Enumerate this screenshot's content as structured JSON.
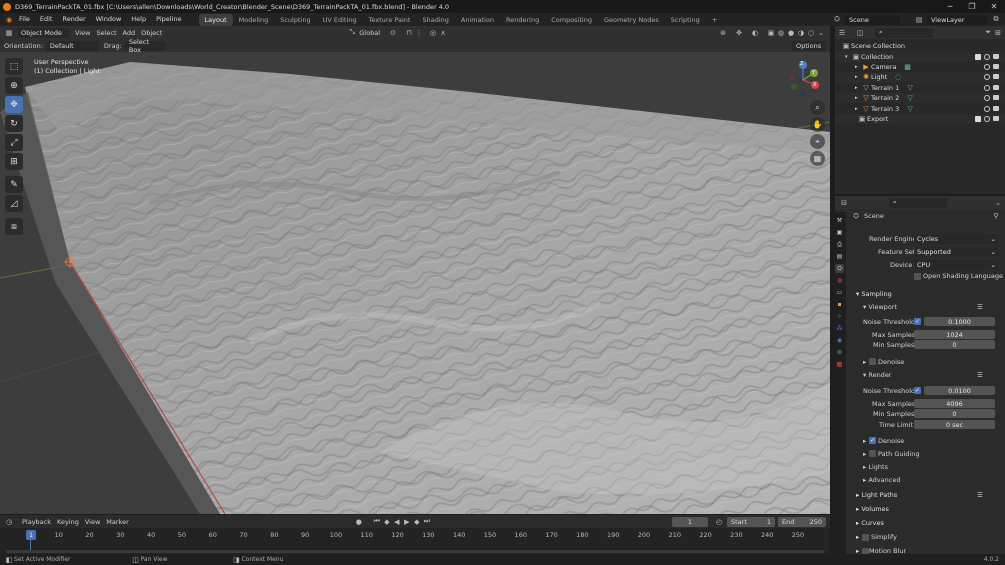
{
  "window": {
    "title": "D369_TerrainPackTA_01.fbx [C:\\Users\\allen\\Downloads\\World_Creator\\Blender_Scene\\D369_TerrainPackTA_01.fbx.blend] - Blender 4.0",
    "minimize": "─",
    "maximize": "❐",
    "close": "✕"
  },
  "menu": [
    "File",
    "Edit",
    "Render",
    "Window",
    "Help",
    "Pipeline"
  ],
  "workspaces": [
    "Layout",
    "Modeling",
    "Sculpting",
    "UV Editing",
    "Texture Paint",
    "Shading",
    "Animation",
    "Rendering",
    "Compositing",
    "Geometry Nodes",
    "Scripting"
  ],
  "active_workspace": "Layout",
  "scene_name": "Scene",
  "view_layer": "ViewLayer",
  "header": {
    "mode": "Object Mode",
    "view": "View",
    "select": "Select",
    "add": "Add",
    "object": "Object",
    "transform": "Global",
    "options": "Options"
  },
  "tool_options": {
    "orientation_label": "Orientation:",
    "orientation_value": "Default",
    "drag_label": "Drag:",
    "drag_value": "Select Box"
  },
  "viewport": {
    "perspective": "User Perspective",
    "collection_info": "(1) Collection | Light"
  },
  "gizmo": {
    "x": "X",
    "y": "Y",
    "z": "Z"
  },
  "outliner": {
    "root": "Scene Collection",
    "items": [
      {
        "name": "Collection",
        "depth": 1,
        "icon": "collection"
      },
      {
        "name": "Camera",
        "depth": 2,
        "icon": "camera"
      },
      {
        "name": "Light",
        "depth": 2,
        "icon": "light"
      },
      {
        "name": "Terrain 1",
        "depth": 2,
        "icon": "mesh"
      },
      {
        "name": "Terrain 2",
        "depth": 2,
        "icon": "mesh"
      },
      {
        "name": "Terrain 3",
        "depth": 2,
        "icon": "mesh"
      },
      {
        "name": "Export",
        "depth": 1,
        "icon": "collection"
      }
    ]
  },
  "properties": {
    "context": "Scene",
    "render_engine_label": "Render Engine",
    "render_engine": "Cycles",
    "feature_set_label": "Feature Set",
    "feature_set": "Supported",
    "device_label": "Device",
    "device": "CPU",
    "osl": "Open Shading Language",
    "sampling": "Sampling",
    "viewport": "Viewport",
    "noise_threshold_label": "Noise Threshold",
    "viewport_noise": "0.1000",
    "max_samples_label": "Max Samples",
    "viewport_max": "1024",
    "min_samples_label": "Min Samples",
    "viewport_min": "0",
    "denoise": "Denoise",
    "render": "Render",
    "render_noise": "0.0100",
    "render_max": "4096",
    "render_min": "0",
    "time_limit_label": "Time Limit",
    "time_limit": "0 sec",
    "path_guiding": "Path Guiding",
    "lights": "Lights",
    "advanced": "Advanced",
    "light_paths": "Light Paths",
    "volumes": "Volumes",
    "curves": "Curves",
    "simplify": "Simplify",
    "motion_blur": "Motion Blur"
  },
  "timeline": {
    "playback": "Playback",
    "keying": "Keying",
    "view": "View",
    "marker": "Marker",
    "current_frame": "1",
    "start_label": "Start",
    "start": "1",
    "end_label": "End",
    "end": "250",
    "ticks": [
      "1",
      "10",
      "20",
      "30",
      "40",
      "50",
      "60",
      "70",
      "80",
      "90",
      "100",
      "110",
      "120",
      "130",
      "140",
      "150",
      "160",
      "170",
      "180",
      "190",
      "200",
      "210",
      "220",
      "230",
      "240",
      "250"
    ]
  },
  "status": {
    "left": "Set Active Modifier",
    "middle": "Pan View",
    "right": "Context Menu",
    "version": "4.0.2"
  },
  "colors": {
    "accent": "#4772b3",
    "blender_orange": "#e87d0d"
  }
}
